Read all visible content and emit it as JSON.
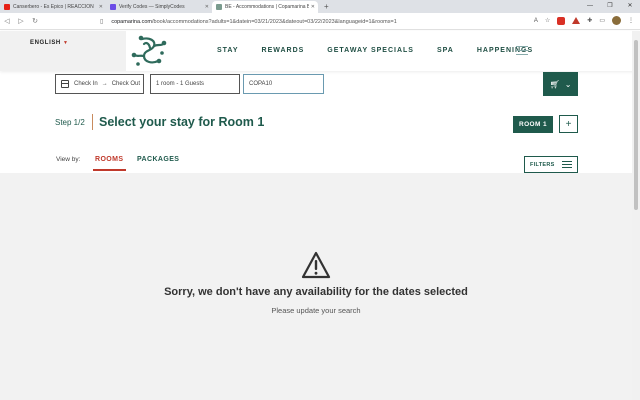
{
  "browser": {
    "tabs": [
      {
        "title": "Canserbero - Es Épico | REACCIÓN",
        "color": "#e62117"
      },
      {
        "title": "Verify Codes — SimplyCodes",
        "color": "#6b4ce6"
      },
      {
        "title": "BE - Accommodations | Copamarina Beach",
        "color": "#7a9b8e"
      }
    ],
    "url_host": "copamarina.com",
    "url_path": "/book/accommodations?adults=1&datein=03/21/2023&dateout=03/22/2023&languageid=1&rooms=1",
    "new_tab": "+",
    "window_controls": [
      "—",
      "❐",
      "✕"
    ]
  },
  "header": {
    "language": "ENGLISH",
    "nav": [
      "STAY",
      "REWARDS",
      "GETAWAY SPECIALS",
      "SPA",
      "HAPPENINGS"
    ]
  },
  "search": {
    "check_in": "Check In",
    "check_out": "Check Out",
    "rooms": "1 room - 1 Guests",
    "promo_code": "COPA10"
  },
  "step": {
    "label": "Step 1/2",
    "title": "Select your stay for Room 1",
    "room_button": "ROOM 1",
    "add_button": "+"
  },
  "view": {
    "label": "View by:",
    "tabs": [
      "ROOMS",
      "PACKAGES"
    ],
    "filters": "FILTERS"
  },
  "empty": {
    "message": "Sorry, we don't have any availability for the dates selected",
    "hint": "Please update your search"
  },
  "colors": {
    "brand": "#1f5a4c",
    "accent": "#c0392b"
  }
}
